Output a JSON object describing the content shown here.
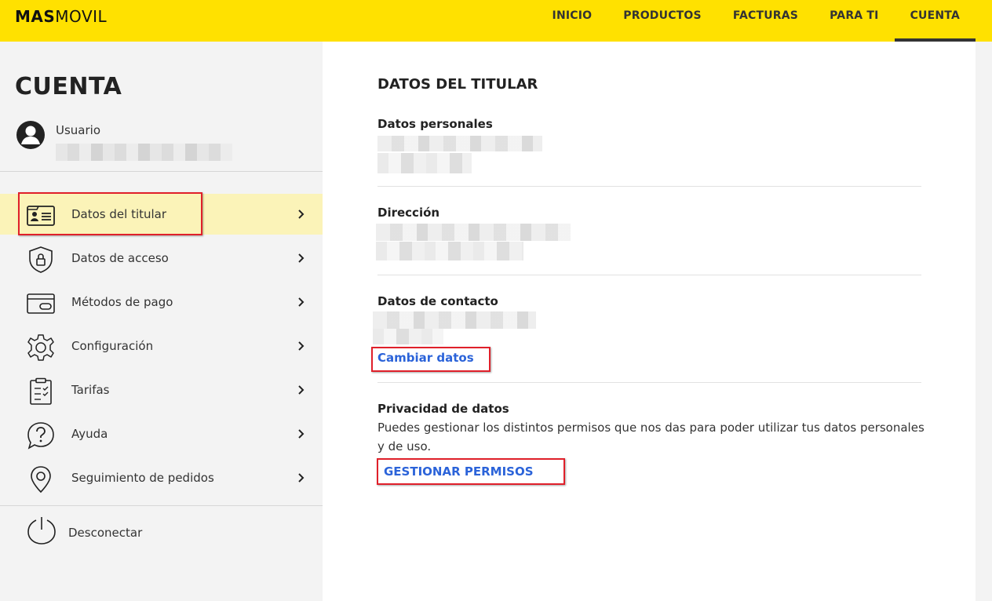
{
  "brand": {
    "logo_bold": "MAS",
    "logo_light": "MOVIL",
    "accent": "#ffe100"
  },
  "nav": {
    "items": [
      {
        "label": "INICIO"
      },
      {
        "label": "PRODUCTOS"
      },
      {
        "label": "FACTURAS"
      },
      {
        "label": "PARA TI"
      },
      {
        "label": "CUENTA"
      }
    ],
    "active": "CUENTA"
  },
  "sidebar": {
    "title": "CUENTA",
    "user_label": "Usuario",
    "menu": [
      {
        "label": "Datos del titular",
        "icon": "id-card-icon",
        "active": true
      },
      {
        "label": "Datos de acceso",
        "icon": "shield-lock-icon"
      },
      {
        "label": "Métodos de pago",
        "icon": "credit-card-icon"
      },
      {
        "label": "Configuración",
        "icon": "gear-icon"
      },
      {
        "label": "Tarifas",
        "icon": "clipboard-check-icon"
      },
      {
        "label": "Ayuda",
        "icon": "question-icon"
      },
      {
        "label": "Seguimiento de pedidos",
        "icon": "location-pin-icon"
      }
    ],
    "logout_label": "Desconectar"
  },
  "main": {
    "title": "DATOS DEL TITULAR",
    "personal_label": "Datos personales",
    "address_label": "Dirección",
    "contact_label": "Datos de contacto",
    "change_link": "Cambiar datos",
    "privacy_label": "Privacidad de datos",
    "privacy_text": "Puedes gestionar los distintos permisos que nos das para poder utilizar tus datos personales y de uso.",
    "permissions_link": "GESTIONAR PERMISOS"
  },
  "colors": {
    "link": "#2b63d9",
    "highlight": "#e0202a",
    "active_row": "#fbf3b8"
  }
}
